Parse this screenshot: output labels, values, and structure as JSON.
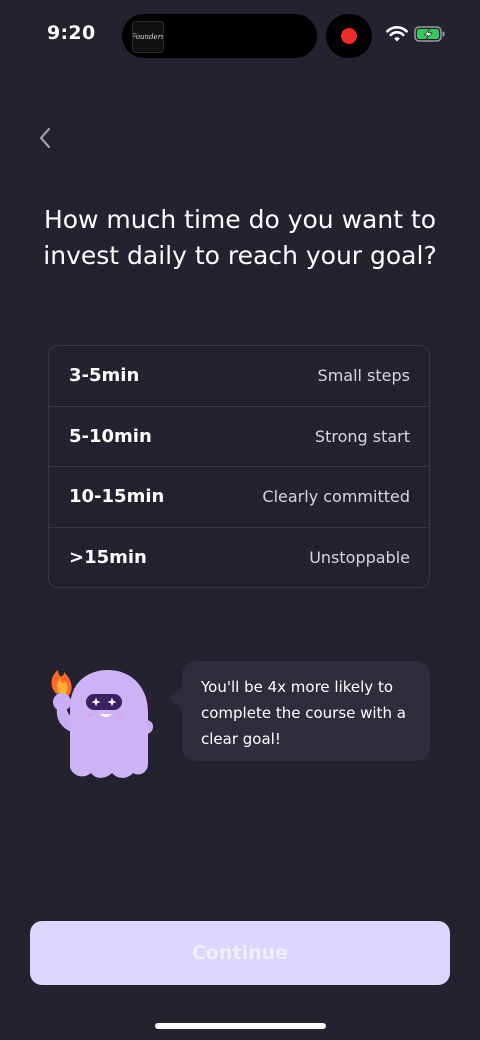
{
  "status_bar": {
    "time": "9:20",
    "island_thumbnail_text": "Founders",
    "icons": [
      "recording-dot-icon",
      "wifi-icon",
      "battery-charging-icon"
    ],
    "record_color": "#ef2b2b",
    "battery_color": "#34c759"
  },
  "nav": {
    "back_icon": "chevron-left-icon"
  },
  "question": {
    "title": "How much time do you want to invest daily to reach your goal?"
  },
  "options": [
    {
      "time": "3-5min",
      "label": "Small steps"
    },
    {
      "time": "5-10min",
      "label": "Strong start"
    },
    {
      "time": "10-15min",
      "label": "Clearly committed"
    },
    {
      "time": ">15min",
      "label": "Unstoppable"
    }
  ],
  "mascot": {
    "icon": "ghost-mascot-icon",
    "accessory_icon": "flame-torch-icon",
    "body_color": "#cdb2f5"
  },
  "tip": {
    "text": "You'll be 4x more likely to complete the course with a clear goal!"
  },
  "footer": {
    "continue_label": "Continue",
    "button_color": "#ddd5fb"
  },
  "theme": {
    "background": "#24222f",
    "border": "#3a3847",
    "bubble": "#2f2d3b"
  }
}
